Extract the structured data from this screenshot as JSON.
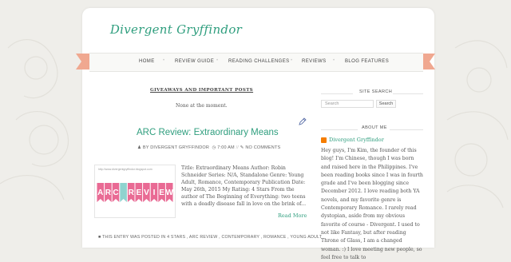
{
  "site": {
    "title": "Divergent Gryffindor"
  },
  "nav": {
    "items": [
      {
        "label": "HOME"
      },
      {
        "label": "REVIEW GUIDE"
      },
      {
        "label": "READING CHALLENGES"
      },
      {
        "label": "REVIEWS"
      },
      {
        "label": "BLOG FEATURES"
      }
    ]
  },
  "giveaways": {
    "heading": "GIVEAWAYS AND IMPORTANT POSTS",
    "text": "None at the moment."
  },
  "post": {
    "title": "ARC Review: Extraordinary Means",
    "meta_author": "BY DIVERGENT GRYFFINDOR",
    "meta_time": "7:00 AM",
    "meta_comments": "NO COMMENTS",
    "thumb_url": "http://www.divergentgryffindor.blogspot.com",
    "thumb_banner": "ARC REVIEW",
    "excerpt": "Title: Extraordinary Means Author: Robin Schneider Series: N/A, Standalone Genre: Young Adult, Romance, Contemporary Publication Date: May 26th, 2015 My Rating: 4 Stars   From the author of The Beginning of Everything: two teens with a deadly disease fall in love on the brink of...",
    "read_more": "Read More",
    "tags": "THIS ENTRY WAS POSTED IN 4 STARS , ARC REVIEW , CONTEMPORARY , ROMANCE , YOUNG ADULT"
  },
  "sidebar": {
    "search_heading": "SITE SEARCH",
    "search_placeholder": "Search",
    "search_button": "Search",
    "about_heading": "ABOUT ME",
    "author_name": "Divergent Gryffindor",
    "about_text": "Hey guys, I'm Kim, the founder of this blog! I'm Chinese, though I was born and raised here in the Philippines. I've been reading books since I was in fourth grade and I've been blogging since December 2012. I love reading both YA novels, and my favorite genre is Contemporary Romance. I rarely read dystopian, aside from my obvious favorite of course - Divergent. I used to not like Fantasy, but after reading Throne of Glass, I am a changed woman. :) I love meeting new people, so feel free to talk to"
  },
  "colors": {
    "accent": "#2f9e7e",
    "ribbon": "#f0a890",
    "page_bg": "#efeeea",
    "banner_pink": "#e96a94",
    "banner_teal": "#8fd3cf"
  }
}
